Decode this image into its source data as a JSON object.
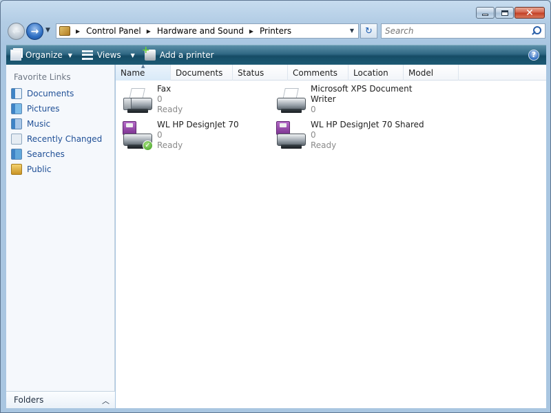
{
  "window": {
    "caption": {
      "minimize": "minimize",
      "maximize": "maximize",
      "close": "close"
    }
  },
  "address": {
    "crumbs": [
      "Control Panel",
      "Hardware and Sound",
      "Printers"
    ]
  },
  "search": {
    "placeholder": "Search"
  },
  "toolbar": {
    "organize": "Organize",
    "views": "Views",
    "add_printer": "Add a printer",
    "help": "?"
  },
  "nav": {
    "title": "Favorite Links",
    "links": [
      {
        "label": "Documents",
        "icon": "documents-icon"
      },
      {
        "label": "Pictures",
        "icon": "pictures-icon"
      },
      {
        "label": "Music",
        "icon": "music-icon"
      },
      {
        "label": "Recently Changed",
        "icon": "recently-changed-icon"
      },
      {
        "label": "Searches",
        "icon": "searches-icon"
      },
      {
        "label": "Public",
        "icon": "public-folder-icon"
      }
    ],
    "folders": "Folders"
  },
  "columns": [
    "Name",
    "Documents",
    "Status",
    "Comments",
    "Location",
    "Model"
  ],
  "items": [
    {
      "name": "Fax",
      "docs": "0",
      "status": "Ready",
      "icon": "fax-icon"
    },
    {
      "name": "Microsoft XPS Document",
      "name2": "Writer",
      "docs": "0",
      "status": "",
      "icon": "printer-icon"
    },
    {
      "name": "WL HP DesignJet 70",
      "docs": "0",
      "status": "Ready",
      "icon": "printer-default-icon"
    },
    {
      "name": "WL HP DesignJet 70 Shared",
      "docs": "0",
      "status": "Ready",
      "icon": "printer-shared-icon"
    }
  ]
}
